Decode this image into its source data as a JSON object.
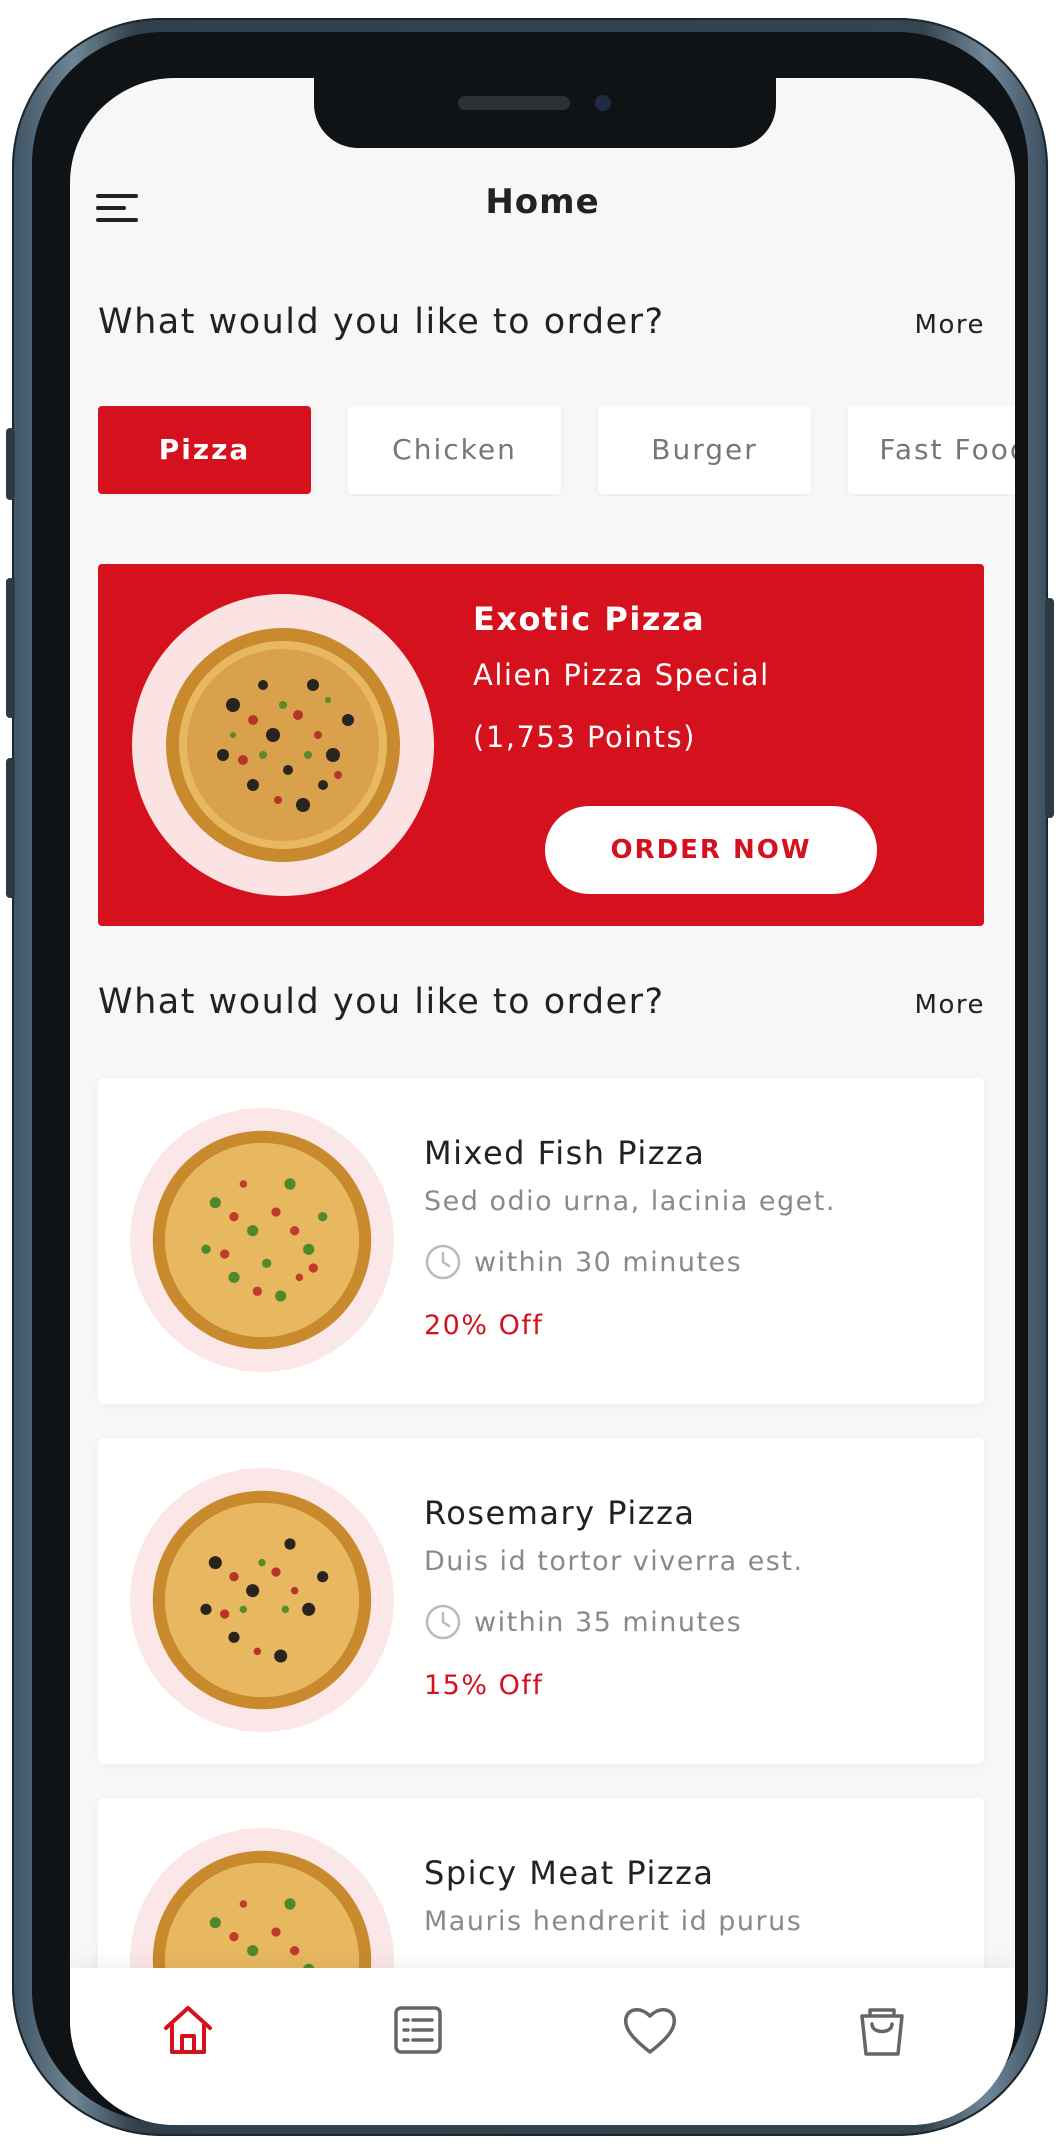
{
  "header": {
    "title": "Home",
    "menu_icon": "hamburger-menu-icon"
  },
  "section_categories": {
    "title": "What would you like to order?",
    "more_label": "More"
  },
  "categories": [
    {
      "label": "Pizza",
      "active": true
    },
    {
      "label": "Chicken",
      "active": false
    },
    {
      "label": "Burger",
      "active": false
    },
    {
      "label": "Fast Food",
      "active": false
    }
  ],
  "banner": {
    "title": "Exotic Pizza",
    "subtitle": "Alien Pizza Special",
    "points": "(1,753 Points)",
    "button_label": "ORDER NOW"
  },
  "section_items": {
    "title": "What would you like to order?",
    "more_label": "More"
  },
  "items": [
    {
      "name": "Mixed Fish Pizza",
      "description": "Sed odio urna, lacinia eget.",
      "time": "within 30 minutes",
      "discount": "20% Off"
    },
    {
      "name": "Rosemary Pizza",
      "description": "Duis id tortor viverra est.",
      "time": "within 35 minutes",
      "discount": "15% Off"
    },
    {
      "name": "Spicy Meat Pizza",
      "description": "Mauris hendrerit id purus",
      "time": "",
      "discount": ""
    }
  ],
  "bottom_nav": [
    {
      "icon": "home-icon",
      "active": true
    },
    {
      "icon": "menu-list-icon",
      "active": false
    },
    {
      "icon": "heart-icon",
      "active": false
    },
    {
      "icon": "shopping-bag-icon",
      "active": false
    }
  ],
  "colors": {
    "accent": "#d4111c",
    "background": "#f7f7f7",
    "card": "#ffffff",
    "text_primary": "#222222",
    "text_secondary": "#8a8a8a",
    "plate_tint": "#fbe7e7"
  }
}
